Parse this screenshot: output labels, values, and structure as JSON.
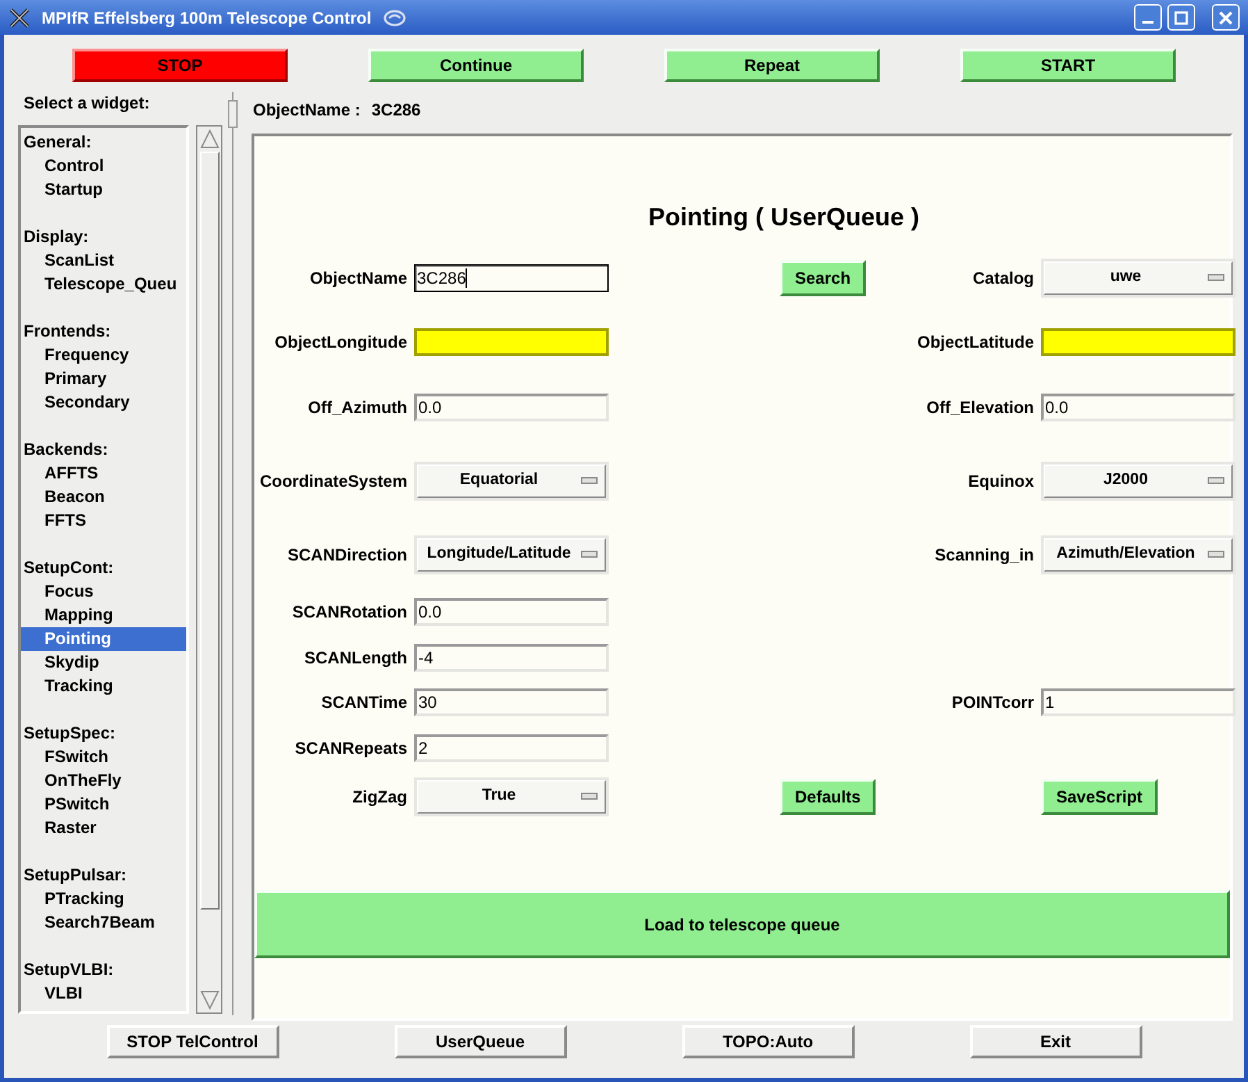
{
  "window": {
    "title": "MPIfR Effelsberg 100m Telescope Control"
  },
  "top_buttons": [
    {
      "label": "STOP",
      "kind": "danger"
    },
    {
      "label": "Continue",
      "kind": "go"
    },
    {
      "label": "Repeat",
      "kind": "go"
    },
    {
      "label": "START",
      "kind": "go"
    }
  ],
  "sidebar": {
    "title": "Select a widget:",
    "groups": [
      {
        "label": "General:",
        "items": [
          {
            "label": "Control",
            "selected": false
          },
          {
            "label": "Startup",
            "selected": false
          }
        ]
      },
      {
        "label": "Display:",
        "items": [
          {
            "label": "ScanList",
            "selected": false
          },
          {
            "label": "Telescope_Queu",
            "selected": false
          }
        ]
      },
      {
        "label": "Frontends:",
        "items": [
          {
            "label": "Frequency",
            "selected": false
          },
          {
            "label": "Primary",
            "selected": false
          },
          {
            "label": "Secondary",
            "selected": false
          }
        ]
      },
      {
        "label": "Backends:",
        "items": [
          {
            "label": "AFFTS",
            "selected": false
          },
          {
            "label": "Beacon",
            "selected": false
          },
          {
            "label": "FFTS",
            "selected": false
          }
        ]
      },
      {
        "label": "SetupCont:",
        "items": [
          {
            "label": "Focus",
            "selected": false
          },
          {
            "label": "Mapping",
            "selected": false
          },
          {
            "label": "Pointing",
            "selected": true
          },
          {
            "label": "Skydip",
            "selected": false
          },
          {
            "label": "Tracking",
            "selected": false
          }
        ]
      },
      {
        "label": "SetupSpec:",
        "items": [
          {
            "label": "FSwitch",
            "selected": false
          },
          {
            "label": "OnTheFly",
            "selected": false
          },
          {
            "label": "PSwitch",
            "selected": false
          },
          {
            "label": "Raster",
            "selected": false
          }
        ]
      },
      {
        "label": "SetupPulsar:",
        "items": [
          {
            "label": "PTracking",
            "selected": false
          },
          {
            "label": "Search7Beam",
            "selected": false
          }
        ]
      },
      {
        "label": "SetupVLBI:",
        "items": [
          {
            "label": "VLBI",
            "selected": false
          }
        ]
      }
    ]
  },
  "header": {
    "label": "ObjectName :",
    "value": "3C286"
  },
  "form": {
    "title": "Pointing ( UserQueue )",
    "rows": [
      {
        "left": {
          "label": "ObjectName",
          "kind": "entry",
          "value": "3C286",
          "focused": true,
          "highlighted": false
        },
        "middle": {
          "kind": "button",
          "label": "Search"
        },
        "right": {
          "label": "Catalog",
          "kind": "dropdown",
          "value": "uwe"
        }
      },
      {
        "left": {
          "label": "ObjectLongitude",
          "kind": "entry",
          "focused": false,
          "highlighted": true
        },
        "right": {
          "label": "ObjectLatitude",
          "kind": "entry",
          "focused": false,
          "highlighted": true
        }
      },
      {
        "left": {
          "label": "Off_Azimuth",
          "kind": "entry",
          "value": "0.0",
          "focused": false,
          "highlighted": false
        },
        "right": {
          "label": "Off_Elevation",
          "kind": "entry",
          "value": "0.0",
          "focused": false,
          "highlighted": false
        }
      },
      {
        "left": {
          "label": "CoordinateSystem",
          "kind": "dropdown",
          "value": "Equatorial"
        },
        "right": {
          "label": "Equinox",
          "kind": "dropdown",
          "value": "J2000"
        }
      },
      {
        "left": {
          "label": "SCANDirection",
          "kind": "dropdown",
          "value": "Longitude/Latitude"
        },
        "right": {
          "label": "Scanning_in",
          "kind": "dropdown",
          "value": "Azimuth/Elevation"
        }
      },
      {
        "left": {
          "label": "SCANRotation",
          "kind": "entry",
          "value": "0.0",
          "focused": false,
          "highlighted": false
        }
      },
      {
        "left": {
          "label": "SCANLength",
          "kind": "entry",
          "value": "-4",
          "focused": false,
          "highlighted": false
        }
      },
      {
        "left": {
          "label": "SCANTime",
          "kind": "entry",
          "value": "30",
          "focused": false,
          "highlighted": false
        },
        "right": {
          "label": "POINTcorr",
          "kind": "entry",
          "value": "1",
          "focused": false,
          "highlighted": false
        }
      },
      {
        "left": {
          "label": "SCANRepeats",
          "kind": "entry",
          "value": "2",
          "focused": false,
          "highlighted": false
        }
      },
      {
        "left": {
          "label": "ZigZag",
          "kind": "dropdown",
          "value": "True"
        },
        "middle": {
          "kind": "button",
          "label": "Defaults"
        },
        "right": {
          "kind": "button",
          "label": "SaveScript"
        }
      }
    ],
    "load_button": "Load to telescope queue"
  },
  "bottom_buttons": [
    "STOP TelControl",
    "UserQueue",
    "TOPO:Auto",
    "Exit"
  ]
}
